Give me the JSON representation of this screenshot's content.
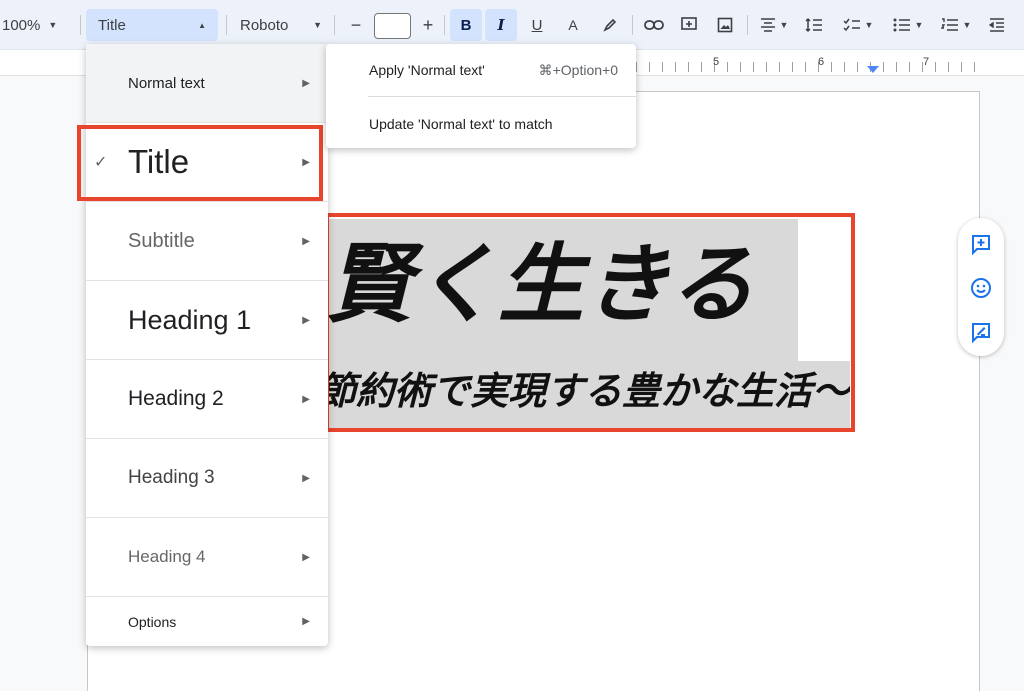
{
  "toolbar": {
    "zoom": "100%",
    "paragraph_style": "Title",
    "font": "Roboto",
    "font_size": "",
    "decrease_size": "−",
    "increase_size": "+",
    "bold": "B",
    "italic": "I",
    "underline": "U",
    "text_color": "A"
  },
  "ruler": {
    "numbers": [
      "5",
      "6",
      "7"
    ]
  },
  "style_menu": {
    "items": [
      {
        "label": "Normal text"
      },
      {
        "label": "Title",
        "checked": true
      },
      {
        "label": "Subtitle"
      },
      {
        "label": "Heading 1"
      },
      {
        "label": "Heading 2"
      },
      {
        "label": "Heading 3"
      },
      {
        "label": "Heading 4"
      },
      {
        "label": "Options"
      }
    ],
    "check_mark": "✓",
    "arrow": "▶"
  },
  "submenu": {
    "apply_label": "Apply 'Normal text'",
    "apply_shortcut": "⌘+Option+0",
    "update_label": "Update 'Normal text' to match"
  },
  "document": {
    "title": "賢く生きる",
    "subtitle": "〜節約術で実現する豊かな生活〜"
  },
  "colors": {
    "highlight_box": "#e8442e",
    "selection": "#d9d9d9",
    "accent": "#1a73e8"
  }
}
